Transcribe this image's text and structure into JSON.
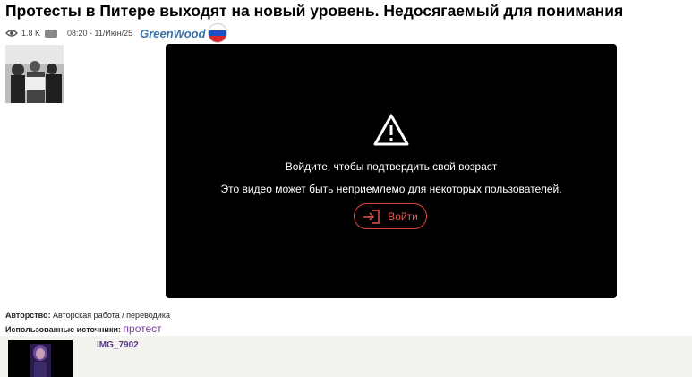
{
  "article": {
    "title": "Протесты в Питере выходят на новый уровень. Недосягаемый для понимания",
    "views": "1.8 K",
    "date": "08:20 - 11/Июн/25",
    "author": "GreenWood"
  },
  "video": {
    "heading": "Войдите, чтобы подтвердить свой возраст",
    "subtext": "Это видео может быть неприемлемо для некоторых пользователей.",
    "login_label": "Войти",
    "accent": "#e0453c"
  },
  "credits": {
    "authorship_label": "Авторство:",
    "authorship_value": "Авторская работа / переводика",
    "sources_label": "Использованные источники:",
    "sources_tag": "протест"
  },
  "related": {
    "title": "IMG_7902"
  },
  "icons": [
    "eye-icon",
    "comment-icon",
    "russia-flag-icon",
    "warning-icon",
    "login-icon"
  ]
}
